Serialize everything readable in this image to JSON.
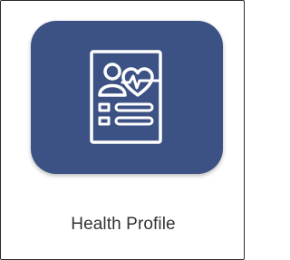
{
  "app": {
    "tile": {
      "label": "Health Profile",
      "icon": "health-profile-icon",
      "tile_color": "#3d5284",
      "icon_color": "#ffffff",
      "text_color": "#333333"
    }
  }
}
